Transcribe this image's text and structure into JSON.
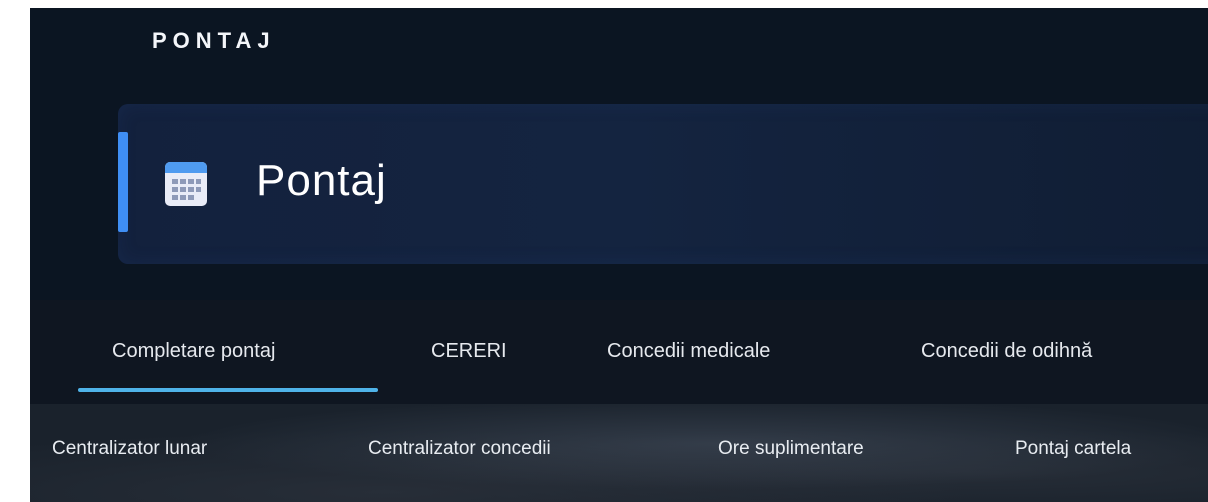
{
  "section": {
    "title": "PONTAJ"
  },
  "module": {
    "label": "Pontaj",
    "icon": "calendar-icon",
    "chevron_icon": "chevron-right-icon"
  },
  "tabs": [
    {
      "label": "Completare pontaj",
      "active": true
    },
    {
      "label": "CERERI"
    },
    {
      "label": "Concedii medicale"
    },
    {
      "label": "Concedii de odihnă"
    }
  ],
  "subnav": [
    {
      "label": "Centralizator lunar"
    },
    {
      "label": "Centralizator concedii"
    },
    {
      "label": "Ore suplimentare"
    },
    {
      "label": "Pontaj cartela"
    }
  ],
  "colors": {
    "background": "#0b1522",
    "card": "#13213d",
    "accent": "#3f8ef4",
    "tab_indicator": "#4fb3e8"
  }
}
